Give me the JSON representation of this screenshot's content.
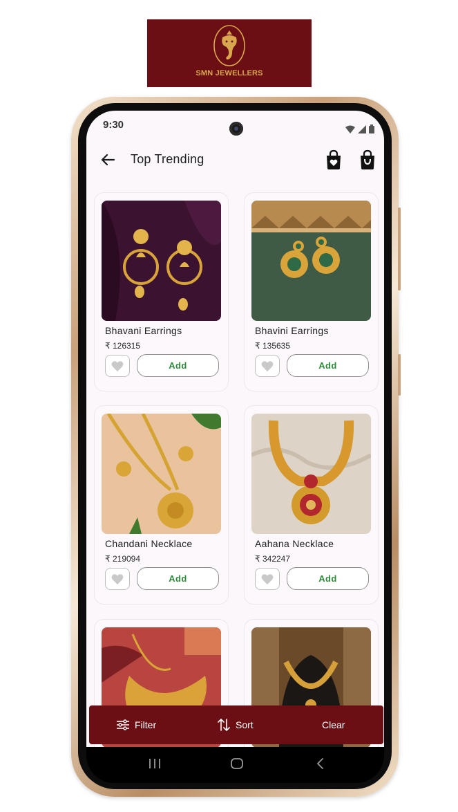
{
  "brand": {
    "name": "SMN JEWELLERS",
    "bg_color": "#6b0f15",
    "text_color": "#d9a84e"
  },
  "status_bar": {
    "time": "9:30",
    "icons": [
      "wifi-icon",
      "signal-icon",
      "battery-icon"
    ]
  },
  "header": {
    "title": "Top Trending",
    "back_icon": "arrow-left-icon",
    "wishlist_icon": "bag-heart-icon",
    "cart_icon": "shopping-bag-icon"
  },
  "products": [
    {
      "name": "Bhavani Earrings",
      "price": "₹ 126315",
      "add_label": "Add"
    },
    {
      "name": "Bhavini Earrings",
      "price": "₹ 135635",
      "add_label": "Add"
    },
    {
      "name": "Chandani Necklace",
      "price": "₹ 219094",
      "add_label": "Add"
    },
    {
      "name": "Aahana Necklace",
      "price": "₹ 342247",
      "add_label": "Add"
    },
    {
      "name": "",
      "price": "",
      "add_label": ""
    },
    {
      "name": "",
      "price": "",
      "add_label": ""
    }
  ],
  "actions": {
    "filter": {
      "label": "Filter",
      "icon": "sliders-icon"
    },
    "sort": {
      "label": "Sort",
      "icon": "sort-arrows-icon"
    },
    "clear": {
      "label": "Clear"
    }
  },
  "nav": {
    "icons": [
      "recents-icon",
      "home-icon",
      "back-icon"
    ]
  },
  "colors": {
    "accent": "#6b0f15",
    "add_text": "#2e8b3a",
    "screen_bg": "#fcf7fb"
  }
}
